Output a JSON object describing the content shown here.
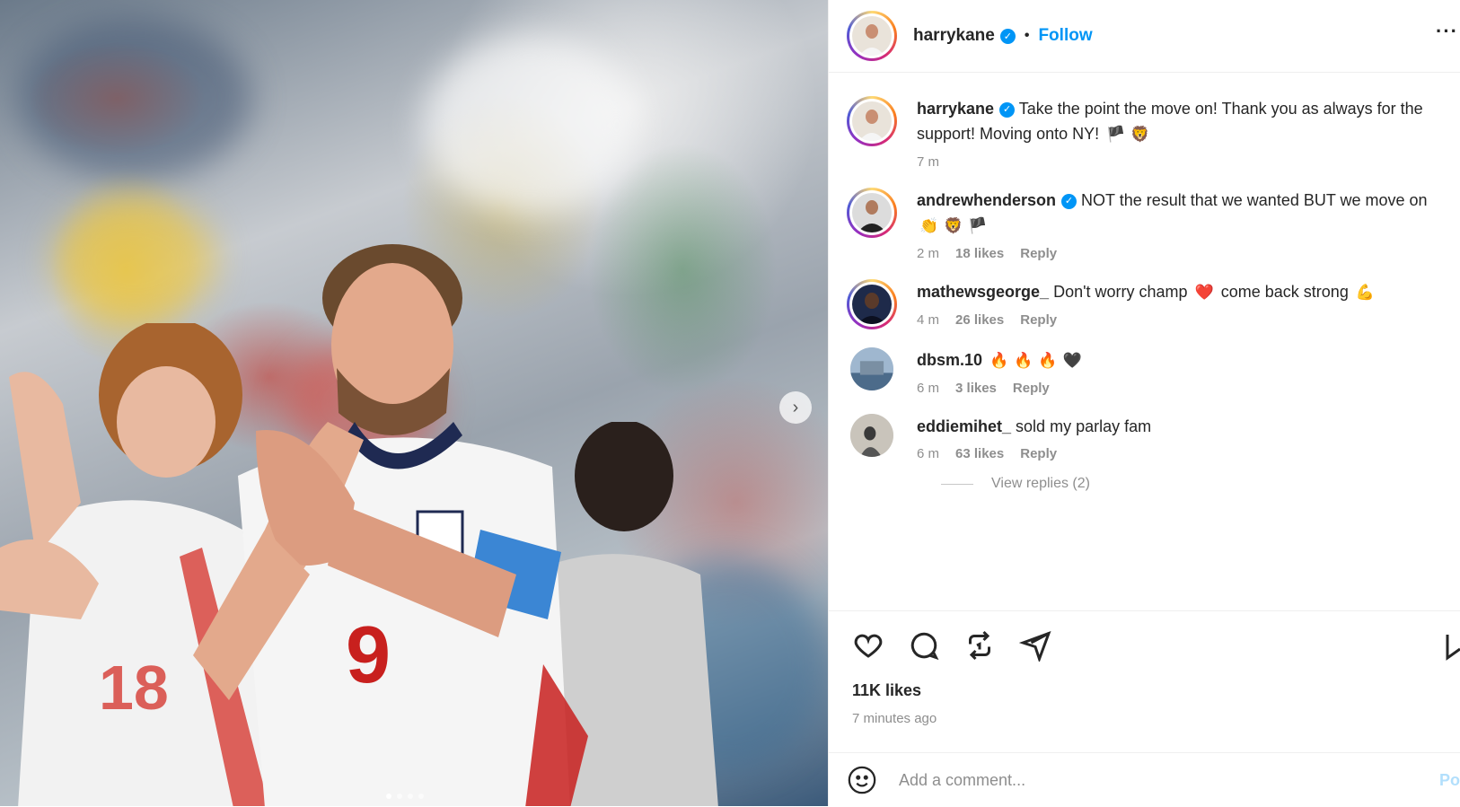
{
  "post": {
    "username": "harrykane",
    "follow_label": "Follow",
    "separator": "•",
    "more_label": "···",
    "caption": {
      "text": "Take the point the move on! Thank you as always for the support! Moving onto NY!",
      "emojis": [
        "🏴",
        "🦁"
      ],
      "time": "7 m"
    },
    "likes": "11K likes",
    "posted_ago": "7 minutes ago",
    "next_arrow": "›",
    "carousel_dots": 4
  },
  "comments": [
    {
      "username": "andrewhenderson",
      "verified": true,
      "text": "NOT the result that we wanted BUT we move on",
      "emojis": [
        "👏",
        "🦁",
        "🏴"
      ],
      "time": "2 m",
      "likes": "18 likes",
      "reply": "Reply"
    },
    {
      "username": "mathewsgeorge_",
      "verified": false,
      "text": "Don't worry champ",
      "text2": "come back strong",
      "emojis": [
        "❤️"
      ],
      "emojis2": [
        "💪"
      ],
      "time": "4 m",
      "likes": "26 likes",
      "reply": "Reply"
    },
    {
      "username": "dbsm.10",
      "verified": false,
      "text": "",
      "emojis": [
        "🔥",
        "🔥",
        "🔥",
        "🖤"
      ],
      "time": "6 m",
      "likes": "3 likes",
      "reply": "Reply"
    },
    {
      "username": "eddiemihet_",
      "verified": false,
      "text": "sold my parlay fam",
      "emojis": [],
      "time": "6 m",
      "likes": "63 likes",
      "reply": "Reply"
    }
  ],
  "view_replies": "View replies (2)",
  "composer": {
    "placeholder": "Add a comment...",
    "post_label": "Po",
    "emoji_icon": "smiley-icon"
  },
  "colors": {
    "accent": "#0095f6",
    "muted": "#8e8e8e",
    "post_disabled": "#b2dffc"
  },
  "icons": [
    "heart-icon",
    "comment-icon",
    "repost-icon",
    "share-icon",
    "bookmark-icon"
  ]
}
